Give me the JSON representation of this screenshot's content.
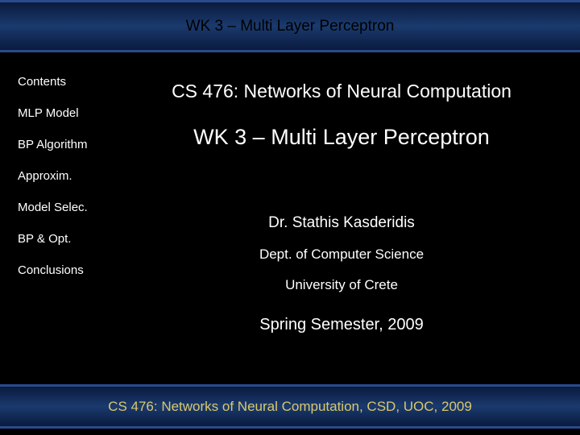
{
  "header": {
    "title": "WK 3 – Multi Layer Perceptron"
  },
  "sidebar": {
    "items": [
      {
        "label": "Contents"
      },
      {
        "label": "MLP Model"
      },
      {
        "label": "BP Algorithm"
      },
      {
        "label": "Approxim."
      },
      {
        "label": "Model Selec."
      },
      {
        "label": "BP & Opt."
      },
      {
        "label": "Conclusions"
      }
    ]
  },
  "main": {
    "course_title": "CS 476: Networks of Neural Computation",
    "week_title": "WK 3 – Multi Layer Perceptron",
    "author": "Dr. Stathis Kasderidis",
    "department": "Dept. of Computer Science",
    "university": "University of Crete",
    "semester": "Spring Semester, 2009"
  },
  "footer": {
    "text": "CS 476: Networks of Neural Computation, CSD, UOC, 2009"
  }
}
